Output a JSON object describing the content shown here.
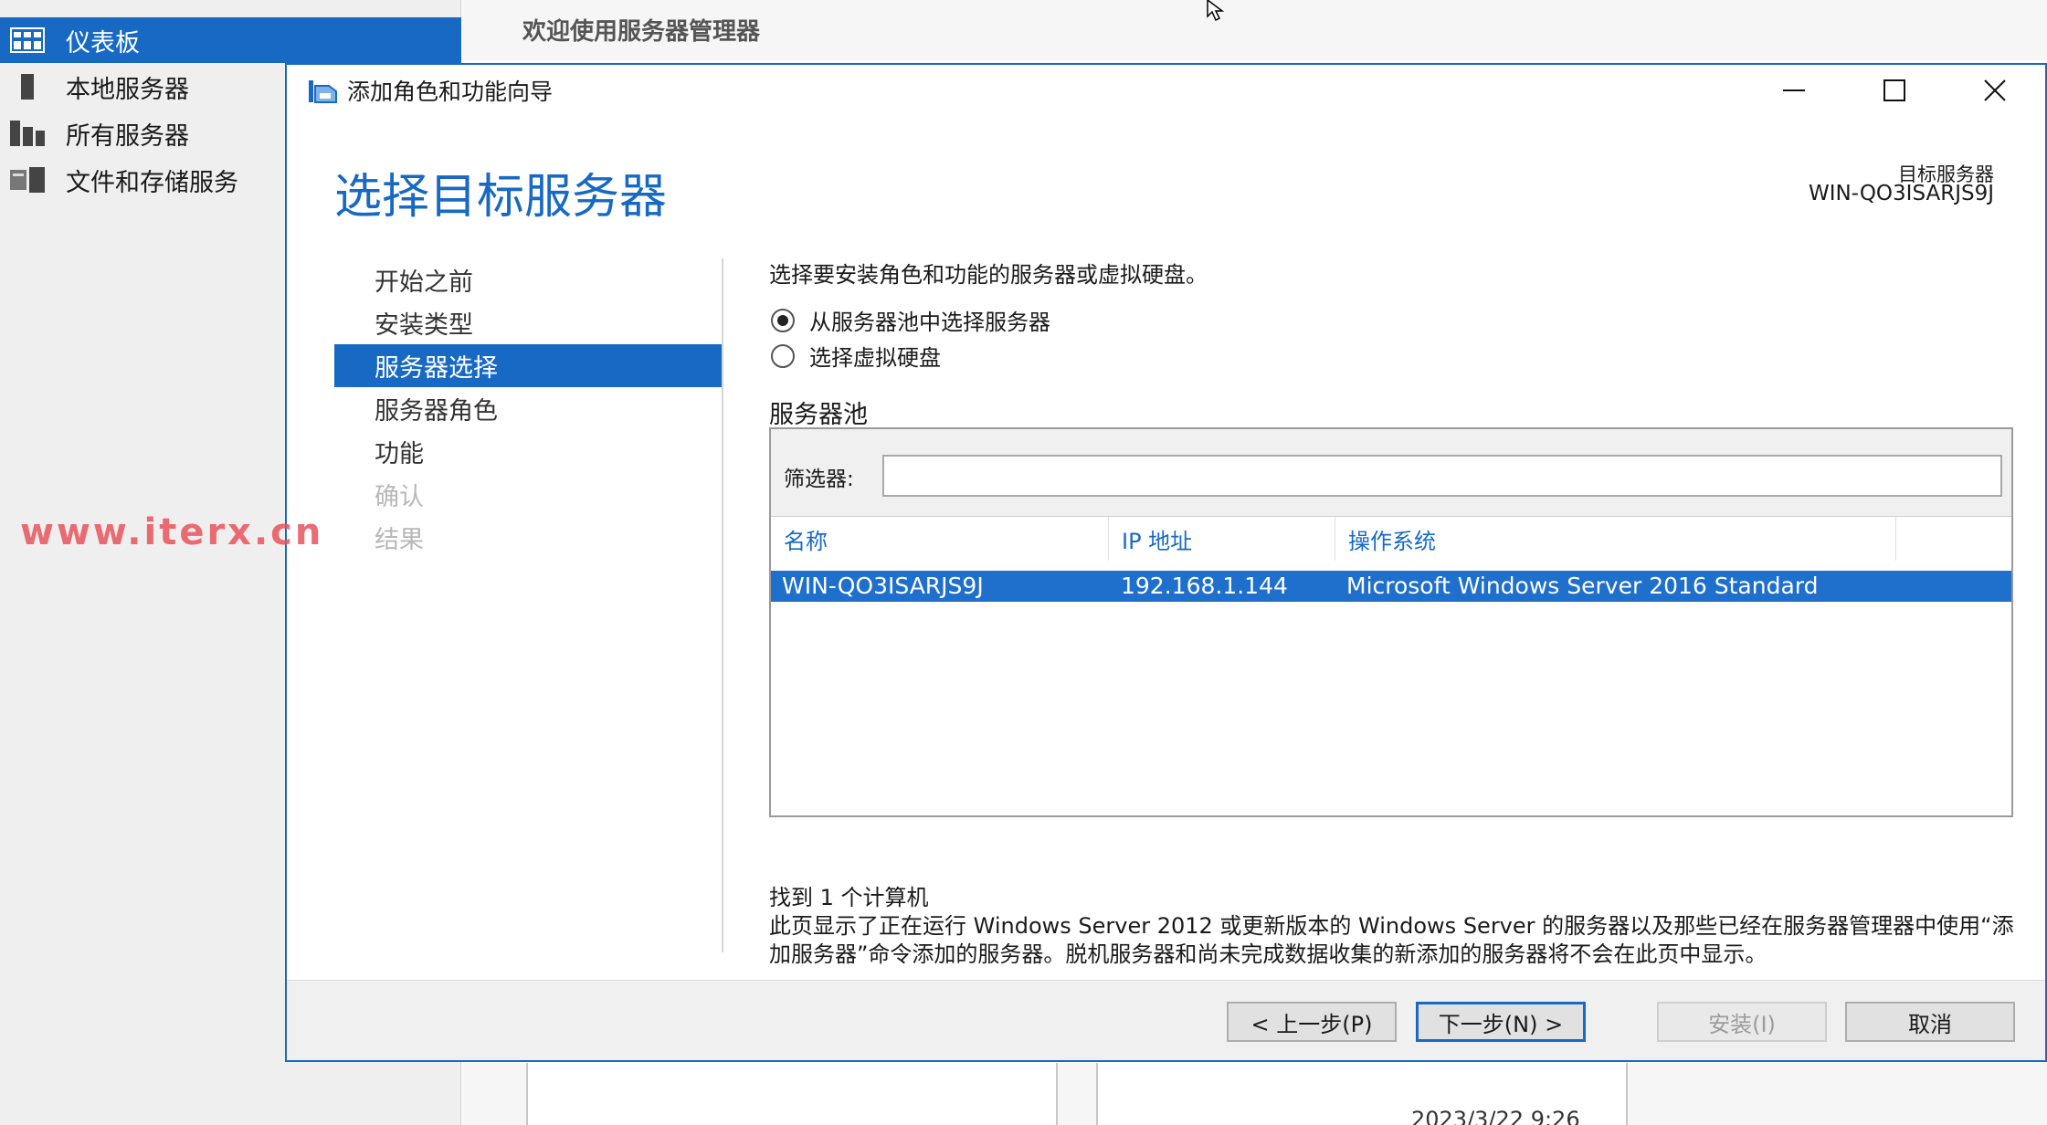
{
  "server_manager": {
    "nav": [
      {
        "label": "仪表板",
        "icon": "dashboard-icon",
        "active": true
      },
      {
        "label": "本地服务器",
        "icon": "local-server-icon"
      },
      {
        "label": "所有服务器",
        "icon": "all-servers-icon"
      },
      {
        "label": "文件和存储服务",
        "icon": "file-storage-icon"
      }
    ],
    "header_title": "欢迎使用服务器管理器",
    "bottom_timestamp": "2023/3/22 9:26"
  },
  "watermark": "www.iterx.cn",
  "wizard": {
    "window_title": "添加角色和功能向导",
    "page_title": "选择目标服务器",
    "target_server_label": "目标服务器",
    "target_server_value": "WIN-QO3ISARJS9J",
    "steps": [
      {
        "label": "开始之前",
        "state": "normal"
      },
      {
        "label": "安装类型",
        "state": "normal"
      },
      {
        "label": "服务器选择",
        "state": "active"
      },
      {
        "label": "服务器角色",
        "state": "normal"
      },
      {
        "label": "功能",
        "state": "normal"
      },
      {
        "label": "确认",
        "state": "disabled"
      },
      {
        "label": "结果",
        "state": "disabled"
      }
    ],
    "intro": "选择要安装角色和功能的服务器或虚拟硬盘。",
    "options": [
      {
        "label": "从服务器池中选择服务器",
        "checked": true
      },
      {
        "label": "选择虚拟硬盘",
        "checked": false
      }
    ],
    "pool_label": "服务器池",
    "filter_label": "筛选器:",
    "filter_value": "",
    "columns": [
      "名称",
      "IP 地址",
      "操作系统"
    ],
    "rows": [
      {
        "name": "WIN-QO3ISARJS9J",
        "ip": "192.168.1.144",
        "os": "Microsoft Windows Server 2016 Standard",
        "selected": true
      }
    ],
    "found_text": "找到 1 个计算机",
    "description": "此页显示了正在运行 Windows Server 2012 或更新版本的 Windows Server 的服务器以及那些已经在服务器管理器中使用“添加服务器”命令添加的服务器。脱机服务器和尚未完成数据收集的新添加的服务器将不会在此页中显示。",
    "buttons": {
      "prev": "< 上一步(P)",
      "next": "下一步(N) >",
      "install": "安装(I)",
      "cancel": "取消"
    }
  },
  "colors": {
    "accent": "#1769c4",
    "selection": "#1f6fcc",
    "watermark": "#e8535c"
  }
}
